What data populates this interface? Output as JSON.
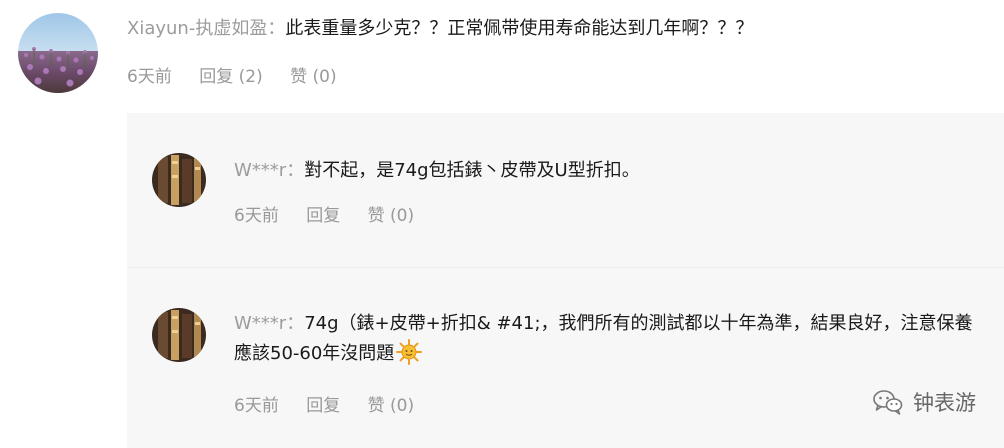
{
  "main_comment": {
    "author": "Xiayun-执虚如盈",
    "separator": "：",
    "text": "此表重量多少克？？正常佩带使用寿命能达到几年啊？？？",
    "time": "6天前",
    "reply_label": "回复 (2)",
    "like_label": "赞 (0)"
  },
  "replies": [
    {
      "author": "W***r",
      "separator": "：",
      "text": "對不起，是74g包括錶丶皮帶及U型折扣。",
      "time": "6天前",
      "reply_label": "回复",
      "like_label": "赞 (0)"
    },
    {
      "author": "W***r",
      "separator": "：",
      "text": "74g（錶+皮帶+折扣& #41;，我們所有的測試都以十年為準，結果良好，注意保養應該50-60年沒問題",
      "time": "6天前",
      "reply_label": "回复",
      "like_label": "赞 (0)"
    }
  ],
  "watermark": {
    "text": "钟表游",
    "icon": "wechat-icon"
  },
  "colors": {
    "meta_gray": "#999999",
    "reply_bg": "#f7f7f7",
    "author_gray": "#9c9c9c"
  }
}
